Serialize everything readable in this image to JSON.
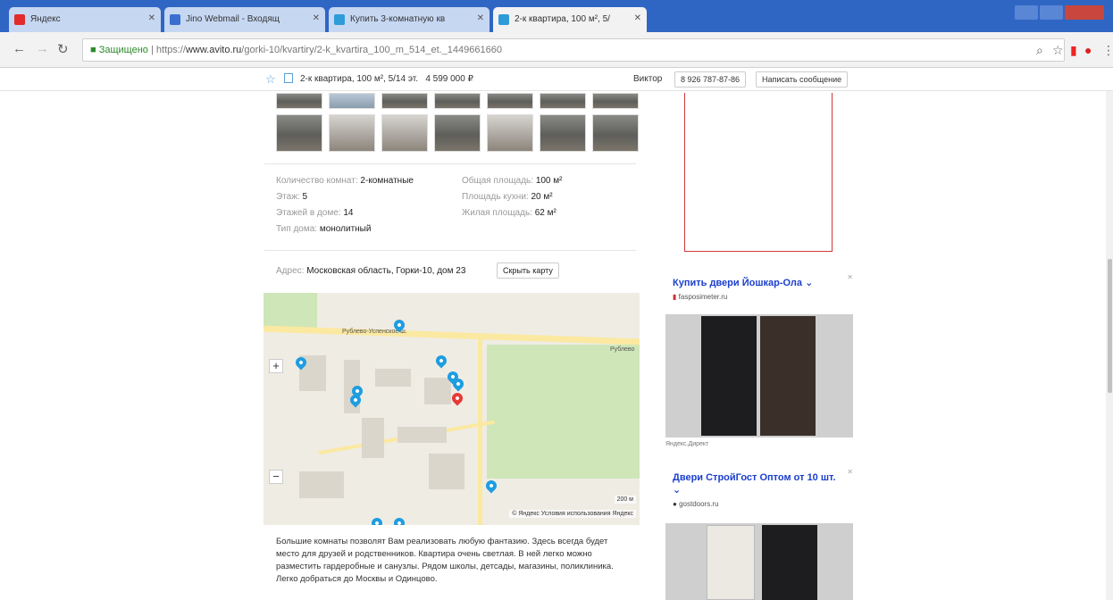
{
  "browser": {
    "tabs": [
      {
        "label": "Яндекс",
        "icon_color": "#e22b2b"
      },
      {
        "label": "Jino Webmail - Входящ",
        "icon_color": "#3a6fd0"
      },
      {
        "label": "Купить 3-комнатную кв",
        "icon_color": "#2f9bd9"
      },
      {
        "label": "2-к квартира, 100 м², 5/",
        "icon_color": "#2f9bd9"
      }
    ],
    "secure_label": "Защищено",
    "url_scheme": "https://",
    "url_host": "www.avito.ru",
    "url_path": "/gorki-10/kvartiry/2-k_kvartira_100_m_514_et._1449661660"
  },
  "header": {
    "listing_title": "2-к квартира, 100 м², 5/14 эт.",
    "price": "4 599 000 ₽",
    "seller": "Виктор",
    "phone": "8 926 787-87-86",
    "message_button": "Написать сообщение"
  },
  "params": {
    "left": [
      {
        "label": "Количество комнат:",
        "value": "2-комнатные"
      },
      {
        "label": "Этаж:",
        "value": "5"
      },
      {
        "label": "Этажей в доме:",
        "value": "14"
      },
      {
        "label": "Тип дома:",
        "value": "монолитный"
      }
    ],
    "right": [
      {
        "label": "Общая площадь:",
        "value": "100 м²"
      },
      {
        "label": "Площадь кухни:",
        "value": "20 м²"
      },
      {
        "label": "Жилая площадь:",
        "value": "62 м²"
      }
    ]
  },
  "address": {
    "label": "Адрес:",
    "value": "Московская область, Горки-10, дом 23",
    "hide_map_button": "Скрыть карту"
  },
  "map": {
    "street_1": "Рублево-Успенское ш.",
    "street_2": "Рублево",
    "zoom_in": "+",
    "zoom_out": "−",
    "scale": "200 м",
    "attribution": "© Яндекс  Условия использования",
    "brand": "Яндекс"
  },
  "description": "Большие комнаты позволят Вам реализовать любую фантазию. Здесь всегда будет место для друзей и родственников. Квартира очень светлая. В ней легко можно разместить гардеробные и санузлы. Рядом школы, детсады, магазины, поликлиника. Легко добраться до Москвы и Одинцово.",
  "ads": [
    {
      "title": "Купить двери Йошкар-Ола",
      "domain": "fasposimeter.ru"
    },
    {
      "title": "Двери СтройГост Оптом от 10 шт.",
      "domain": "gostdoors.ru"
    }
  ],
  "ad_caption": "Яндекс.Директ"
}
